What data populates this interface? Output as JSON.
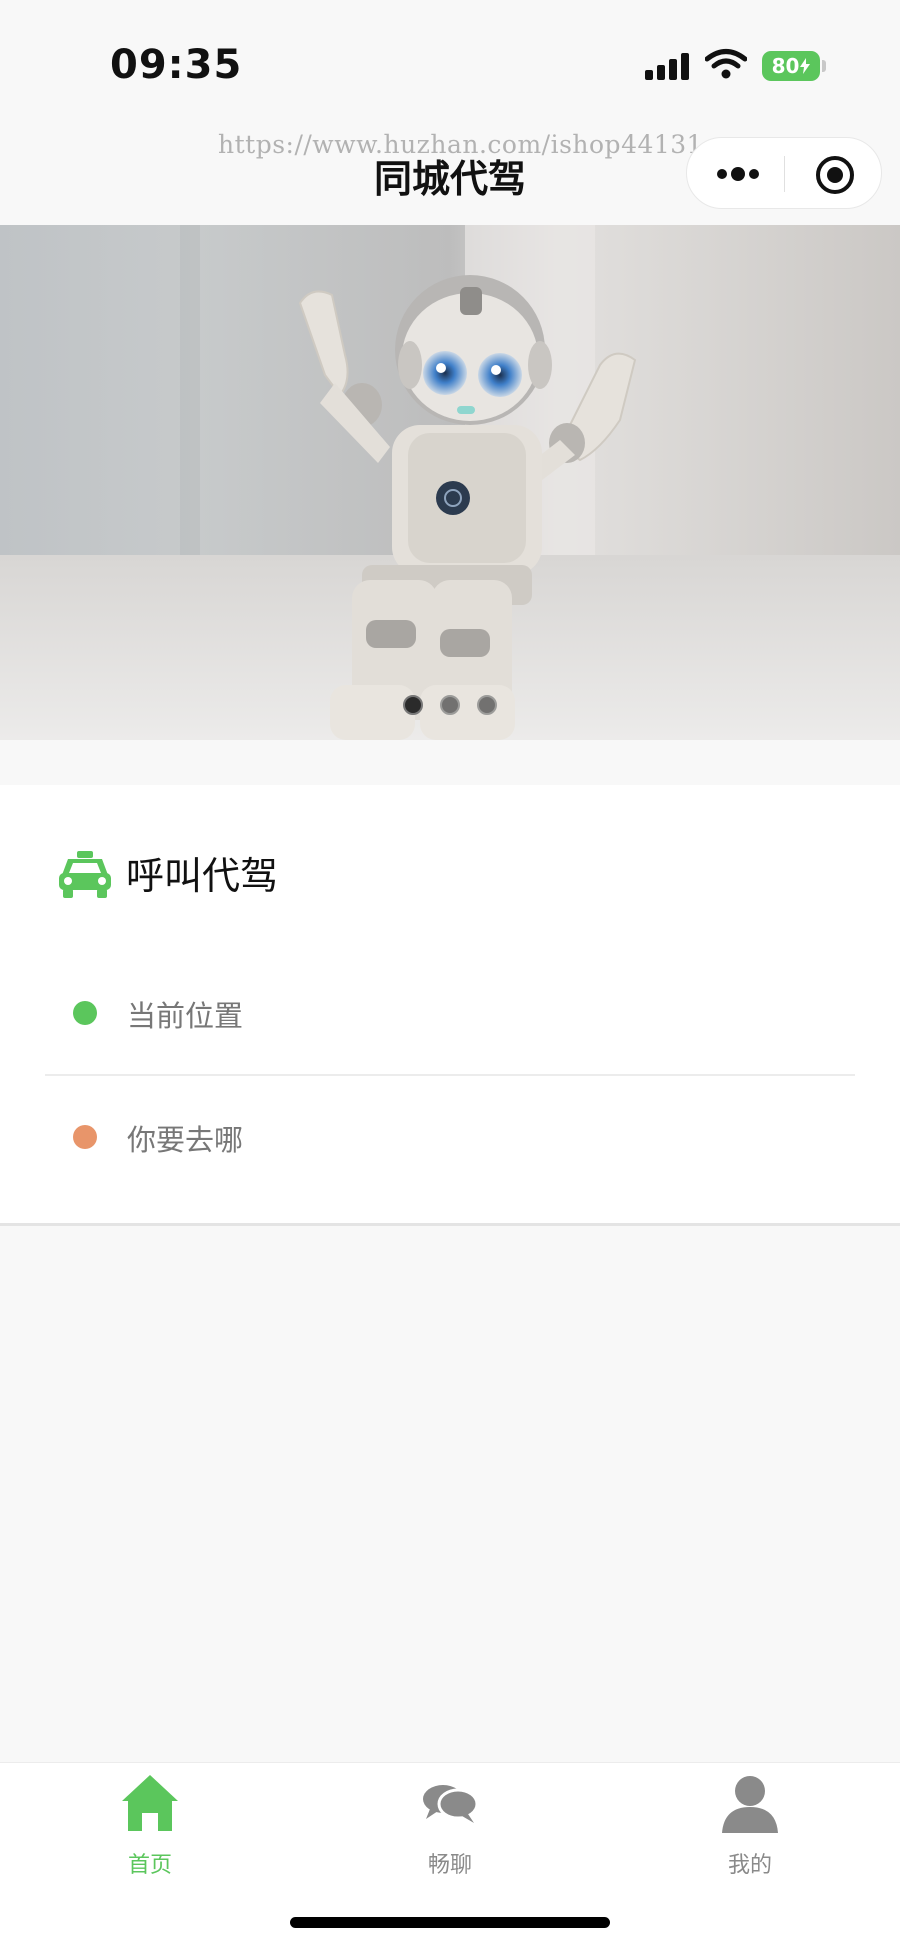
{
  "status_bar": {
    "time": "09:35",
    "battery": "80"
  },
  "watermark": "https://www.huzhan.com/ishop44131",
  "nav": {
    "title": "同城代驾",
    "icons": [
      "more-icon",
      "target-icon"
    ]
  },
  "banner": {
    "slide_count": 3,
    "active_slide": 0
  },
  "call_card": {
    "title": "呼叫代驾",
    "title_icon": "taxi-icon",
    "current_location_label": "当前位置",
    "destination_label": "你要去哪",
    "colors": {
      "start_dot": "#5bc65c",
      "end_dot": "#e8956a"
    }
  },
  "tabbar": {
    "items": [
      {
        "label": "首页",
        "icon": "home-icon",
        "active": true
      },
      {
        "label": "畅聊",
        "icon": "chat-icon",
        "active": false
      },
      {
        "label": "我的",
        "icon": "user-icon",
        "active": false
      }
    ],
    "colors": {
      "active": "#5bc65c",
      "inactive": "#8a8a8a"
    }
  }
}
